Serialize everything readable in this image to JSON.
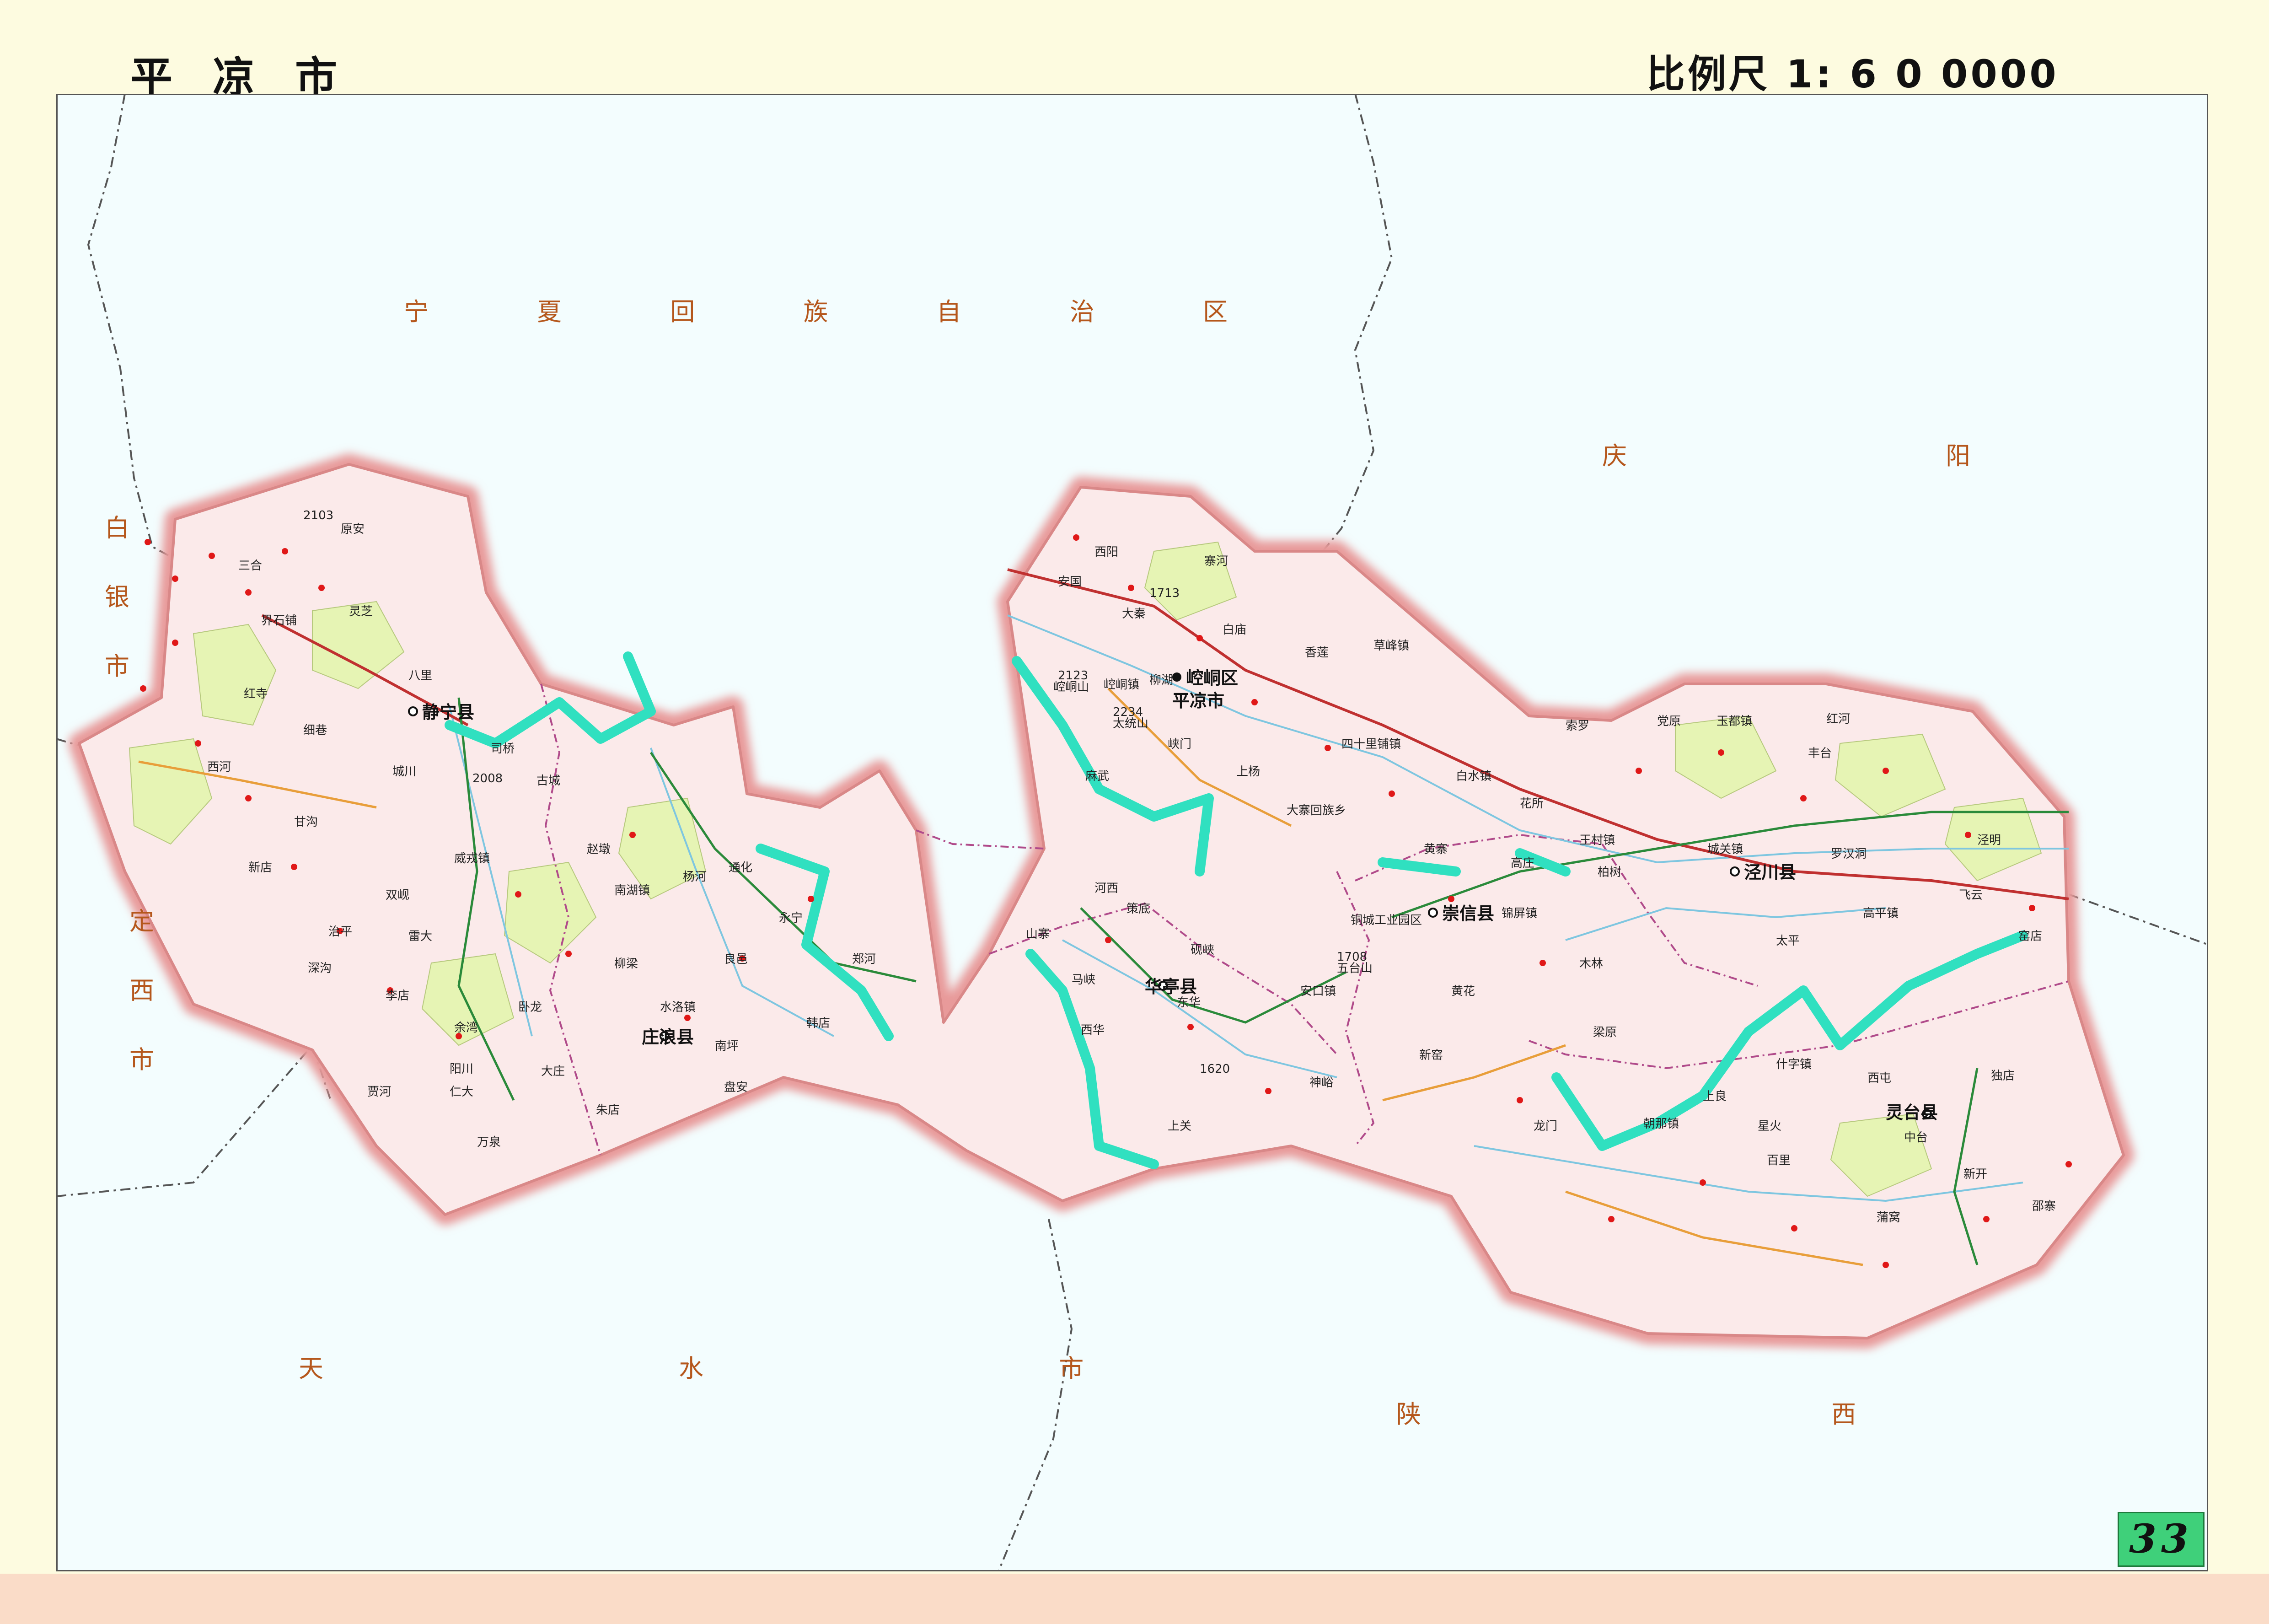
{
  "header": {
    "title": "平 凉 市",
    "scale": "比例尺 1: 6 0 0000"
  },
  "page_number": "33",
  "neighbors": {
    "ningxia": "宁 夏 回 族 自 治 区",
    "qingyang": "庆 阳 市",
    "baiyin": "白 银 市",
    "dingxi": "定 西 市",
    "tianshui": "天 水 市",
    "shaanxi": "陕 西 省"
  },
  "city_seat": {
    "district": "崆峒区",
    "city": "平凉市"
  },
  "counties": {
    "jingning": "静宁县",
    "zhuanglang": "庄浪县",
    "huating": "华亭县",
    "chongxin": "崇信县",
    "jingchuan": "泾川县",
    "lingtai": "灵台县"
  },
  "towns": {
    "sanhe": "三合",
    "yuanan": "原安",
    "jieshipu": "界石铺",
    "lingzhi": "灵芝",
    "bali": "八里",
    "hongsi": "红寺",
    "xiba": "细巷",
    "sihe": "西河",
    "chengchuan": "城川",
    "ganggou": "甘沟",
    "xindian": "新店",
    "weirong": "威戎镇",
    "shuangxian": "双岘",
    "leida": "雷大",
    "zhiping": "治平",
    "shenggou": "深沟",
    "lidian": "李店",
    "yuqi": "余湾",
    "yangchuan": "阳川",
    "xianhe": "贾河",
    "renda": "仁大",
    "sihua": "司桥",
    "gucheng": "古城",
    "zhaodun": "赵墩",
    "nanhu": "南湖镇",
    "yanghe": "杨河",
    "liuliang": "柳梁",
    "shuiluo": "水洛镇",
    "wolong": "卧龙",
    "dazhuang": "大庄",
    "zhuma": "朱店",
    "wanquan": "万泉",
    "tonghua": "通化",
    "yongning": "永宁",
    "liangyi": "良邑",
    "zhenghe": "郑河",
    "handian": "韩店",
    "nanping": "南坪",
    "panan": "盘安",
    "xiyang": "西阳",
    "anguo": "安国",
    "daqin": "大秦",
    "suohe": "寨河",
    "baimiao": "白庙",
    "xianglian": "香莲",
    "caofeng": "草峰镇",
    "kongtongzhen": "崆峒镇",
    "liuhu": "柳湖",
    "xiamen": "峡门",
    "masi": "麻武",
    "shangyang": "上杨",
    "sishilipu": "四十里铺镇",
    "baishui": "白水镇",
    "huasuo": "花所",
    "dazhaihui": "大寨回族乡",
    "huangzhai": "黄寨",
    "gaozhuang": "高庄",
    "tongchenggongye": "铜城工业园区",
    "jinping": "锦屏镇",
    "baijia": "柏树",
    "hexi": "河西",
    "cedi": "策底",
    "shanzhai": "山寨",
    "mahe": "马峡",
    "yanxia": "砚峡",
    "dongha": "东华",
    "xihua": "西华",
    "shangguan": "上关",
    "ankou": "安口镇",
    "shenyu": "神峪",
    "huanghua": "黄花",
    "xinyao": "新窑",
    "muling": "木林",
    "sixiang": "索罗",
    "dangyuan": "党原",
    "yudu": "玉都镇",
    "honghe": "红河",
    "fengtai": "丰台",
    "wangcun": "王村镇",
    "chengguan": "城关镇",
    "luohan": "罗汉洞",
    "jingming": "泾明",
    "feiyun": "飞云",
    "taiping": "太平",
    "gaoping": "高平镇",
    "yaodian": "窑店",
    "lianghan": "梁原",
    "shiliang": "什字镇",
    "xitun": "西屯",
    "dudian": "独店",
    "shangliang": "上良",
    "xinghuo": "星火",
    "chaona": "朝那镇",
    "longmen": "龙门",
    "baili": "百里",
    "zhongtai": "中台",
    "xinkai": "新开",
    "pucun": "蒲窝",
    "shaozhai": "邵寨"
  },
  "peaks": {
    "p1": "2103",
    "p2": "2123",
    "p3": "2234",
    "p4": "太统山",
    "p5": "1713",
    "p6": "1708",
    "p7": "五台山",
    "p8": "1620",
    "p9": "崆峒山",
    "p10": "2008"
  },
  "colors": {
    "county_fill": "#fbeaea",
    "border_glow": "#e89a9a",
    "farm_patch": "#e6f4b4",
    "park_green": "#30e0c0",
    "river": "#7ec6e0",
    "road_orange": "#e89e3a",
    "road_green": "#2a8a3a",
    "railway": "#c03030",
    "village_dot": "#e01818"
  }
}
